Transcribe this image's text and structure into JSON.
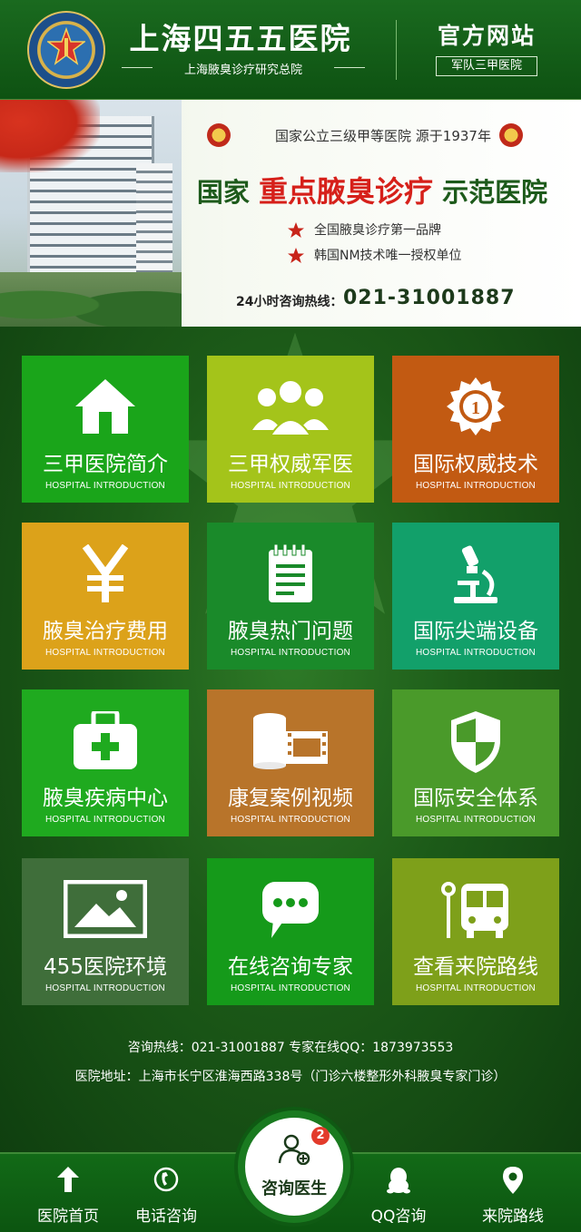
{
  "header": {
    "hospital_name": "上海四五五医院",
    "hospital_subtitle": "上海腋臭诊疗研究总院",
    "official_site": "官方网站",
    "official_badge": "军队三甲医院"
  },
  "banner": {
    "top_line": "国家公立三级甲等医院  源于1937年",
    "headline_prefix": "国家",
    "headline_highlight": "重点腋臭诊疗",
    "headline_suffix": "示范医院",
    "features": [
      "全国腋臭诊疗第一品牌",
      "韩国NM技术唯一授权单位"
    ],
    "hotline_label": "24小时咨询热线：",
    "hotline_number": "021-31001887"
  },
  "tiles": [
    {
      "title": "三甲医院简介",
      "subtitle": "HOSPITAL INTRODUCTION",
      "icon": "house-icon",
      "color": "#1aa51a"
    },
    {
      "title": "三甲权威军医",
      "subtitle": "HOSPITAL INTRODUCTION",
      "icon": "doctors-icon",
      "color": "#a4c41a"
    },
    {
      "title": "国际权威技术",
      "subtitle": "HOSPITAL INTRODUCTION",
      "icon": "medal-icon",
      "color": "#c25a12"
    },
    {
      "title": "腋臭治疗费用",
      "subtitle": "HOSPITAL INTRODUCTION",
      "icon": "yen-icon",
      "color": "#dca21a"
    },
    {
      "title": "腋臭热门问题",
      "subtitle": "HOSPITAL INTRODUCTION",
      "icon": "notepad-icon",
      "color": "#1a8a2a"
    },
    {
      "title": "国际尖端设备",
      "subtitle": "HOSPITAL INTRODUCTION",
      "icon": "microscope-icon",
      "color": "#12a06a"
    },
    {
      "title": "腋臭疾病中心",
      "subtitle": "HOSPITAL INTRODUCTION",
      "icon": "medkit-icon",
      "color": "#1faa1f"
    },
    {
      "title": "康复案例视频",
      "subtitle": "HOSPITAL INTRODUCTION",
      "icon": "film-icon",
      "color": "#b8742a"
    },
    {
      "title": "国际安全体系",
      "subtitle": "HOSPITAL INTRODUCTION",
      "icon": "shield-icon",
      "color": "#4a9a2a"
    },
    {
      "title": "455医院环境",
      "subtitle": "HOSPITAL INTRODUCTION",
      "icon": "picture-icon",
      "color": "#3f6e3a"
    },
    {
      "title": "在线咨询专家",
      "subtitle": "HOSPITAL INTRODUCTION",
      "icon": "chat-icon",
      "color": "#159a1a"
    },
    {
      "title": "查看来院路线",
      "subtitle": "HOSPITAL INTRODUCTION",
      "icon": "bus-icon",
      "color": "#7ea01a"
    }
  ],
  "contact": {
    "line1": "咨询热线：021-31001887    专家在线QQ：1873973553",
    "line2": "医院地址：上海市长宁区淮海西路338号（门诊六楼整形外科腋臭专家门诊）"
  },
  "bottom_nav": {
    "items": [
      "医院首页",
      "电话咨询",
      "QQ咨询",
      "来院路线"
    ],
    "consult_label": "咨询医生",
    "consult_badge": "2"
  }
}
